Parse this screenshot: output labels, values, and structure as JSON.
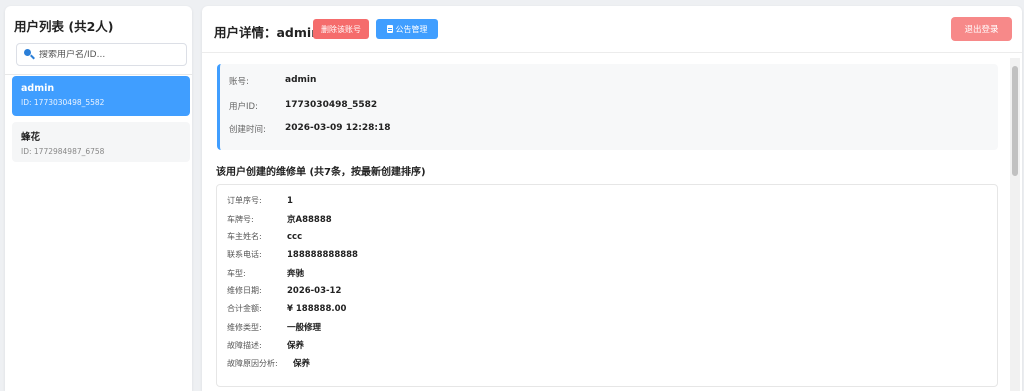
{
  "sidebar": {
    "title": "用户列表 (共2人)",
    "search_placeholder": "搜索用户名/ID...",
    "users": [
      {
        "name": "admin",
        "id": "ID: 1773030498_5582"
      },
      {
        "name": "蜂花",
        "id": "ID: 1772984987_6758"
      }
    ]
  },
  "header": {
    "title": "用户详情：admin",
    "delete_label": "删除该账号",
    "notice_label": "公告管理",
    "logout_label": "退出登录"
  },
  "user_info": [
    {
      "label": "账号:",
      "value": "admin"
    },
    {
      "label": "用户ID:",
      "value": "1773030498_5582"
    },
    {
      "label": "创建时间:",
      "value": "2026-03-09 12:28:18"
    }
  ],
  "orders_section": {
    "title": "该用户创建的维修单 (共7条，按最新创建排序)"
  },
  "order": [
    {
      "label": "订单序号:",
      "value": "1"
    },
    {
      "label": "车牌号:",
      "value": "京A88888"
    },
    {
      "label": "车主姓名:",
      "value": "ccc"
    },
    {
      "label": "联系电话:",
      "value": "188888888888"
    },
    {
      "label": "车型:",
      "value": "奔驰"
    },
    {
      "label": "维修日期:",
      "value": "2026-03-12"
    },
    {
      "label": "合计金额:",
      "value": "¥ 188888.00"
    },
    {
      "label": "维修类型:",
      "value": "一般修理"
    },
    {
      "label": "故障描述:",
      "value": "保养"
    },
    {
      "label": "故障原因分析:",
      "value": "保养"
    }
  ],
  "colors": {
    "primary": "#409eff",
    "danger": "#f56c6c",
    "logout": "#f78989"
  }
}
